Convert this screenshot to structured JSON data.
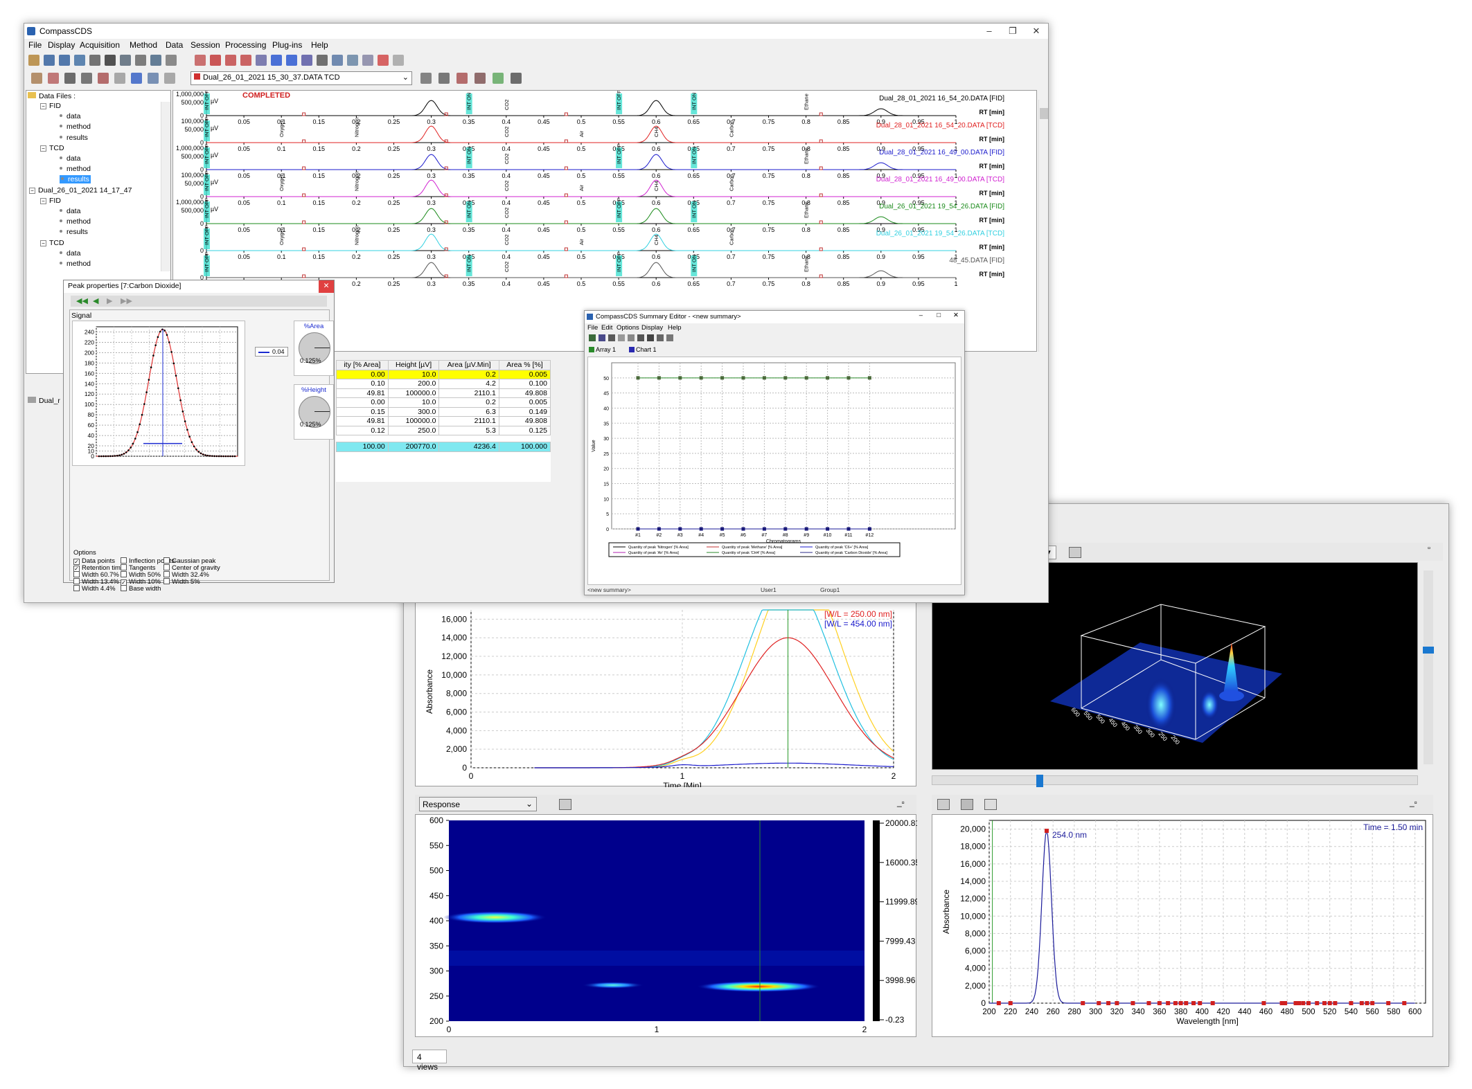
{
  "main_window": {
    "title": "CompassCDS",
    "menu": [
      "File",
      "Display",
      "Acquisition",
      "Method",
      "Data",
      "Session",
      "Processing",
      "Plug-ins",
      "Help"
    ],
    "file_selector": "Dual_26_01_2021 15_30_37.DATA TCD",
    "status_text": "COMPLETED"
  },
  "tree": {
    "header": "Data Files :",
    "items": [
      {
        "label": "FID",
        "level": 1
      },
      {
        "label": "data",
        "level": 2
      },
      {
        "label": "method",
        "level": 2
      },
      {
        "label": "results",
        "level": 2
      },
      {
        "label": "TCD",
        "level": 1
      },
      {
        "label": "data",
        "level": 2
      },
      {
        "label": "method",
        "level": 2
      },
      {
        "label": "results",
        "level": 2,
        "selected": true
      },
      {
        "label": "Dual_26_01_2021 14_17_47",
        "level": 0
      },
      {
        "label": "FID",
        "level": 1
      },
      {
        "label": "data",
        "level": 2
      },
      {
        "label": "method",
        "level": 2
      },
      {
        "label": "results",
        "level": 2
      },
      {
        "label": "TCD",
        "level": 1
      },
      {
        "label": "data",
        "level": 2
      },
      {
        "label": "method",
        "level": 2
      }
    ],
    "lower_header": "Dual_r"
  },
  "chromatograms": {
    "x_ticks": [
      "0",
      "0.05",
      "0.1",
      "0.15",
      "0.2",
      "0.25",
      "0.3",
      "0.35",
      "0.4",
      "0.45",
      "0.5",
      "0.55",
      "0.6",
      "0.65",
      "0.7",
      "0.75",
      "0.8",
      "0.85",
      "0.9",
      "0.95",
      "1"
    ],
    "rt_label": "RT [min]",
    "rows": [
      {
        "name": "Dual_28_01_2021 16_54_20.DATA [FID]",
        "color": "#000000",
        "ytop": "500,000",
        "ytop2": "1,000,000",
        "unit": "µV",
        "type": "FID"
      },
      {
        "name": "Dual_28_01_2021 16_54_20.DATA [TCD]",
        "color": "#e02020",
        "ytop": "50,000",
        "ytop2": "100,000",
        "unit": "µV",
        "type": "TCD"
      },
      {
        "name": "Dual_28_01_2021 16_49_00.DATA [FID]",
        "color": "#1a1acc",
        "ytop": "500,000",
        "ytop2": "1,000,000",
        "unit": "µV",
        "type": "FID"
      },
      {
        "name": "Dual_28_01_2021 16_49_00.DATA [TCD]",
        "color": "#d020d0",
        "ytop": "50,000",
        "ytop2": "100,000",
        "unit": "µV",
        "type": "TCD"
      },
      {
        "name": "Dual_26_01_2021 19_54_26.DATA [FID]",
        "color": "#1a8a1a",
        "ytop": "500,000",
        "ytop2": "1,000,000",
        "unit": "µV",
        "type": "FID"
      },
      {
        "name": "Dual_26_01_2021 19_54_26.DATA [TCD]",
        "color": "#30d0e0",
        "ytop": "",
        "ytop2": "",
        "unit": "",
        "type": "TCD"
      },
      {
        "name": "48_45.DATA [FID]",
        "color": "#555555",
        "ytop": "",
        "ytop2": "",
        "unit": "",
        "type": "FID"
      }
    ],
    "event_labels": {
      "int_on": "INT ON",
      "int_off": "INT OFF",
      "oxygen": "Oxygen",
      "nitrogen": "Nitrogen",
      "co2": "CO2",
      "air": "Air",
      "ch4": "CH4",
      "carbon": "Carbon",
      "ethane": "Ethane"
    }
  },
  "peak_properties": {
    "title": "Peak properties [7:Carbon Dioxide]",
    "tab": "Signal",
    "legend_value": "0.04",
    "y_ticks": [
      "0",
      "10",
      "20",
      "40",
      "60",
      "80",
      "100",
      "120",
      "140",
      "160",
      "180",
      "200",
      "220",
      "240"
    ],
    "area_label": "%Area",
    "area_value": "0.125%",
    "height_label": "%Height",
    "height_value": "0.125%",
    "options_label": "Options",
    "options": [
      {
        "label": "Data points",
        "checked": true
      },
      {
        "label": "Inflection points",
        "checked": false
      },
      {
        "label": "Gaussian peak",
        "checked": false
      },
      {
        "label": "Retention time",
        "checked": true
      },
      {
        "label": "Tangents",
        "checked": false
      },
      {
        "label": "Center of gravity",
        "checked": false
      },
      {
        "label": "Width 60.7%",
        "checked": false
      },
      {
        "label": "Width 50%",
        "checked": false
      },
      {
        "label": "Width 32.4%",
        "checked": false
      },
      {
        "label": "Width 13.4%",
        "checked": false
      },
      {
        "label": "Width 10%",
        "checked": true
      },
      {
        "label": "Width 5%",
        "checked": false
      },
      {
        "label": "Width 4.4%",
        "checked": false
      },
      {
        "label": "Base width",
        "checked": false
      }
    ]
  },
  "results_table": {
    "headers": [
      "ity [% Area]",
      "Height [µV]",
      "Area [µV.Min]",
      "Area % [%]"
    ],
    "rows": [
      [
        "0.00",
        "10.0",
        "0.2",
        "0.005"
      ],
      [
        "0.10",
        "200.0",
        "4.2",
        "0.100"
      ],
      [
        "49.81",
        "100000.0",
        "2110.1",
        "49.808"
      ],
      [
        "0.00",
        "10.0",
        "0.2",
        "0.005"
      ],
      [
        "0.15",
        "300.0",
        "6.3",
        "0.149"
      ],
      [
        "49.81",
        "100000.0",
        "2110.1",
        "49.808"
      ],
      [
        "0.12",
        "250.0",
        "5.3",
        "0.125"
      ]
    ],
    "totals": [
      "100.00",
      "200770.0",
      "4236.4",
      "100.000"
    ]
  },
  "summary_editor": {
    "title": "CompassCDS Summary Editor - <new summary>",
    "menu": [
      "File",
      "Edit",
      "Options",
      "Display",
      "Help"
    ],
    "tabs": [
      "Array 1",
      "Chart 1"
    ],
    "y_ticks": [
      "0",
      "5",
      "10",
      "15",
      "20",
      "25",
      "30",
      "35",
      "40",
      "45",
      "50"
    ],
    "x_ticks": [
      "#1",
      "#2",
      "#3",
      "#4",
      "#5",
      "#6",
      "#7",
      "#8",
      "#9",
      "#10",
      "#11",
      "#12"
    ],
    "xlabel": "Chromatograms",
    "ylabel": "Value",
    "legend": [
      "Quantity of peak 'Nitrogen' [% Area]",
      "Quantity of peak 'Methane' [% Area]",
      "Quantity of peak 'C6+' [% Area]",
      "Quantity of peak 'Air' [% Area]",
      "Quantity of peak 'CH4' [% Area]",
      "Quantity of peak 'Carbon Dioxide' [% Area]"
    ],
    "status": [
      "<new summary>",
      "User1",
      "Group1"
    ]
  },
  "pda_window": {
    "views_label": "4 views",
    "response_select": "Response",
    "chromatogram": {
      "ylabel": "Absorbance",
      "xlabel": "Time [Min]",
      "y_ticks": [
        "0",
        "2,000",
        "4,000",
        "6,000",
        "8,000",
        "10,000",
        "12,000",
        "14,000",
        "16,000"
      ],
      "x_ticks": [
        "0",
        "1",
        "2"
      ],
      "wl1": "[W/L = 250.00 nm]",
      "wl2": "[W/L = 454.00 nm]"
    },
    "map3d": {
      "axis_labels": [
        "600",
        "550",
        "500",
        "450",
        "400",
        "350",
        "300",
        "250",
        "200"
      ]
    },
    "contour": {
      "y_ticks": [
        "600",
        "550",
        "500",
        "450",
        "400",
        "350",
        "300",
        "250",
        "200"
      ],
      "x_ticks": [
        "0",
        "1",
        "2"
      ],
      "scale": [
        "20000.81",
        "16000.35",
        "11999.89",
        "7999.43",
        "3998.96",
        "-0.23"
      ]
    },
    "spectrum": {
      "ylabel": "Absorbance",
      "xlabel": "Wavelength [nm]",
      "time_label": "Time = 1.50 min",
      "peak_label": "254.0 nm",
      "y_ticks": [
        "0",
        "2,000",
        "4,000",
        "6,000",
        "8,000",
        "10,000",
        "12,000",
        "14,000",
        "16,000",
        "18,000",
        "20,000"
      ],
      "x_ticks": [
        "200",
        "220",
        "240",
        "260",
        "280",
        "300",
        "320",
        "340",
        "360",
        "380",
        "400",
        "420",
        "440",
        "460",
        "480",
        "500",
        "520",
        "540",
        "560",
        "580",
        "600"
      ]
    }
  }
}
